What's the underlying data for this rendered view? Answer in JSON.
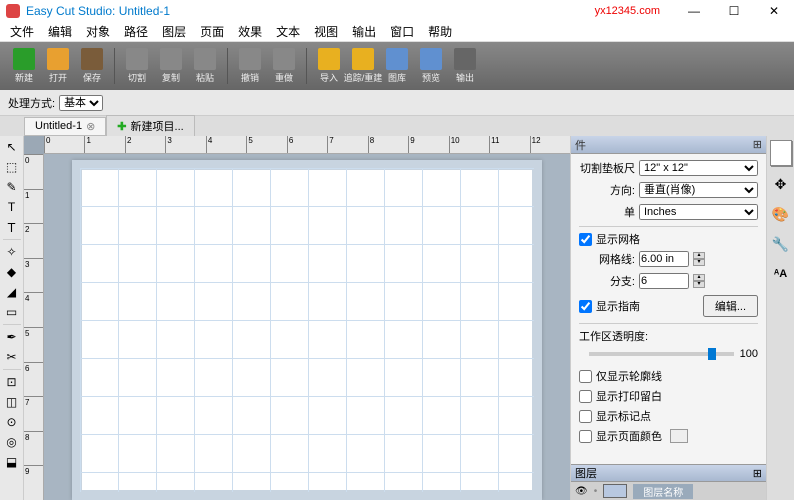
{
  "watermark": "yx12345.com",
  "title": "Easy Cut Studio: Untitled-1",
  "menu": [
    "文件",
    "编辑",
    "对象",
    "路径",
    "图层",
    "页面",
    "效果",
    "文本",
    "视图",
    "输出",
    "窗口",
    "帮助"
  ],
  "toolbar": [
    {
      "label": "新建",
      "color": "#2a9d2a"
    },
    {
      "label": "打开",
      "color": "#e8a030"
    },
    {
      "label": "保存",
      "color": "#7a5c3a"
    },
    {
      "label": "切割",
      "color": "#888"
    },
    {
      "label": "复制",
      "color": "#888"
    },
    {
      "label": "粘贴",
      "color": "#888"
    },
    {
      "label": "撤销",
      "color": "#888"
    },
    {
      "label": "重做",
      "color": "#888"
    },
    {
      "label": "导入",
      "color": "#e8b020"
    },
    {
      "label": "追踪/重建",
      "color": "#e8b020"
    },
    {
      "label": "图库",
      "color": "#6090d0"
    },
    {
      "label": "预览",
      "color": "#6090d0"
    },
    {
      "label": "输出",
      "color": "#666"
    }
  ],
  "optbar": {
    "label": "处理方式:",
    "value": "基本"
  },
  "tabs": {
    "active": "Untitled-1",
    "new": "新建项目..."
  },
  "ruler_h": [
    "0",
    "1",
    "2",
    "3",
    "4",
    "5",
    "6",
    "7",
    "8",
    "9",
    "10",
    "11",
    "12"
  ],
  "ruler_v": [
    "0",
    "1",
    "2",
    "3",
    "4",
    "5",
    "6",
    "7",
    "8",
    "9"
  ],
  "panel": {
    "header": "件",
    "mat_label": "切割垫板尺",
    "mat_value": "12\" x 12\"",
    "orient_label": "方向:",
    "orient_value": "垂直(肖像)",
    "unit_label": "单",
    "unit_value": "Inches",
    "show_grid": "显示网格",
    "gridline_label": "网格线:",
    "gridline_value": "6.00 in",
    "subdiv_label": "分支:",
    "subdiv_value": "6",
    "show_guides": "显示指南",
    "edit_btn": "编辑...",
    "opacity_label": "工作区透明度:",
    "opacity_value": "100",
    "show_outline": "仅显示轮廓线",
    "show_bleed": "显示打印留白",
    "show_marks": "显示标记点",
    "show_pagecolor": "显示页面颜色"
  },
  "layers": {
    "header": "图层",
    "name_header": "图层名称"
  }
}
